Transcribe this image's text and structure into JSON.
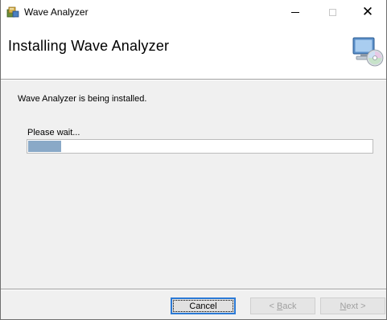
{
  "window": {
    "title": "Wave Analyzer",
    "caption_buttons": {
      "minimize": "minimize",
      "maximize": "maximize",
      "close": "close"
    }
  },
  "banner": {
    "title": "Installing Wave Analyzer"
  },
  "body": {
    "status": "Wave Analyzer is being installed.",
    "wait_label": "Please wait...",
    "progress_fraction": 0.095
  },
  "buttons": {
    "cancel": "Cancel",
    "back_prefix": "< ",
    "back_mnemonic": "B",
    "back_rest": "ack",
    "next_mnemonic": "N",
    "next_rest": "ext >"
  },
  "colors": {
    "progress_fill": "#8aa9c7",
    "focus_border": "#2b7ad6",
    "dialog_bg": "#f0f0f0"
  },
  "icons": {
    "app": "installer-icon",
    "banner": "computer-cd-icon"
  }
}
